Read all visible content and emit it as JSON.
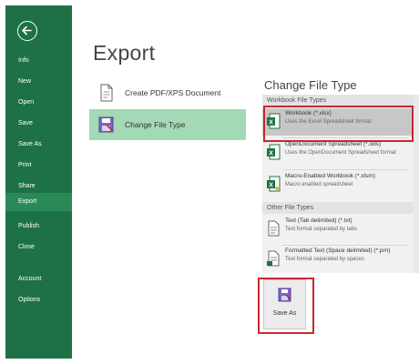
{
  "sidebar": {
    "background": "#1e7145",
    "back_icon": "back-arrow-icon",
    "items": [
      {
        "label": "Info"
      },
      {
        "label": "New"
      },
      {
        "label": "Open"
      },
      {
        "label": "Save"
      },
      {
        "label": "Save As"
      },
      {
        "label": "Print"
      },
      {
        "label": "Share"
      },
      {
        "label": "Export",
        "active": true
      },
      {
        "label": "Publish"
      },
      {
        "label": "Close"
      },
      {
        "label": "Account"
      },
      {
        "label": "Options"
      }
    ]
  },
  "export": {
    "title": "Export",
    "options": [
      {
        "label": "Create PDF/XPS Document",
        "icon": "pdf-document-icon"
      },
      {
        "label": "Change File Type",
        "icon": "change-file-type-icon",
        "selected": true
      }
    ]
  },
  "change_file_type": {
    "title": "Change File Type",
    "groups": [
      {
        "header": "Workbook File Types",
        "items": [
          {
            "name": "Workbook (*.xlsx)",
            "desc": "Uses the Excel Spreadsheet format",
            "highlighted": true
          },
          {
            "name": "OpenDocument Spreadsheet (*.ods)",
            "desc": "Uses the OpenDocument Spreadsheet format"
          },
          {
            "name": "Macro-Enabled Workbook (*.xlsm)",
            "desc": "Macro enabled spreadsheet"
          }
        ]
      },
      {
        "header": "Other File Types",
        "items": [
          {
            "name": "Text (Tab delimited) (*.txt)",
            "desc": "Text format separated by tabs"
          },
          {
            "name": "Formatted Text (Space delimited) (*.prn)",
            "desc": "Text format separated by spaces"
          }
        ]
      }
    ],
    "save_as": {
      "label": "Save As",
      "icon": "save-as-icon"
    }
  },
  "colors": {
    "accent_green": "#1e7145",
    "selected_option": "#a3d9b4",
    "highlight_red": "#c8282d"
  }
}
